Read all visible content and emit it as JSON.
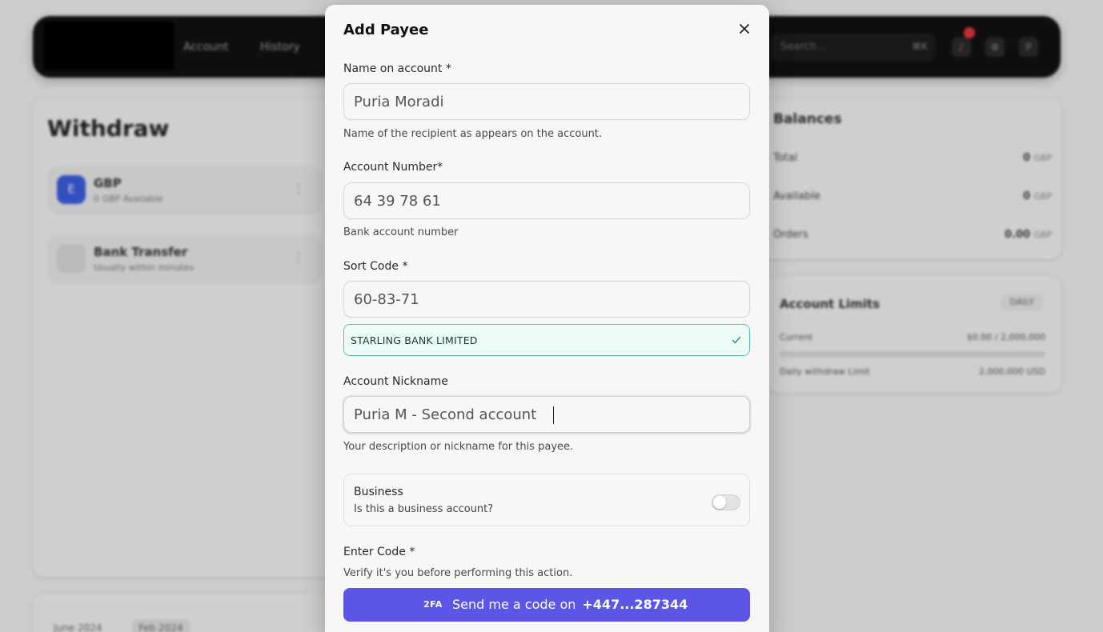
{
  "background": {
    "nav": [
      "Account",
      "History"
    ],
    "search_placeholder": "Search...",
    "search_shortcut": "⌘K",
    "withdraw": {
      "title": "Withdraw",
      "currency_option": {
        "title": "GBP",
        "subtitle": "0 GBP Available",
        "icon": "E"
      },
      "method_option": {
        "title": "Bank Transfer",
        "subtitle": "Usually within minutes"
      }
    },
    "statement_tabs": [
      "June 2024",
      "Feb 2024"
    ],
    "balances": {
      "title": "Balances",
      "rows": [
        {
          "label": "Total",
          "value": "0",
          "unit": "GBP"
        },
        {
          "label": "Available",
          "value": "0",
          "unit": "GBP"
        },
        {
          "label": "Orders",
          "value": "0.00",
          "unit": "GBP"
        }
      ]
    },
    "limits": {
      "title": "Account Limits",
      "period": "DAILY",
      "current_label": "Current",
      "current_value": "$0.00 / 2,000,000",
      "daily_label": "Daily withdraw Limit",
      "daily_value": "2,000,000 USD"
    }
  },
  "modal": {
    "title": "Add Payee",
    "name": {
      "label": "Name on account *",
      "value": "Puria Moradi",
      "help": "Name of the recipient as appears on the account."
    },
    "account_number": {
      "label": "Account Number*",
      "value": "64 39 78 61",
      "help": "Bank account number"
    },
    "sort_code": {
      "label": "Sort Code *",
      "value": "60-83-71",
      "bank_name": "STARLING BANK LIMITED"
    },
    "nickname": {
      "label": "Account Nickname",
      "value": "Puria M - Second account",
      "help": "Your description or nickname for this payee."
    },
    "business": {
      "title": "Business",
      "subtitle": "Is this a business account?",
      "enabled": false
    },
    "code": {
      "label": "Enter Code *",
      "help": "Verify it's you before performing this action.",
      "button_badge": "2FA",
      "button_text": "Send me a code on",
      "button_number": "+447...287344"
    }
  },
  "colors": {
    "primary": "#5b56e6",
    "success_border": "#58c2a6",
    "success_bg": "#ecfbf5"
  }
}
